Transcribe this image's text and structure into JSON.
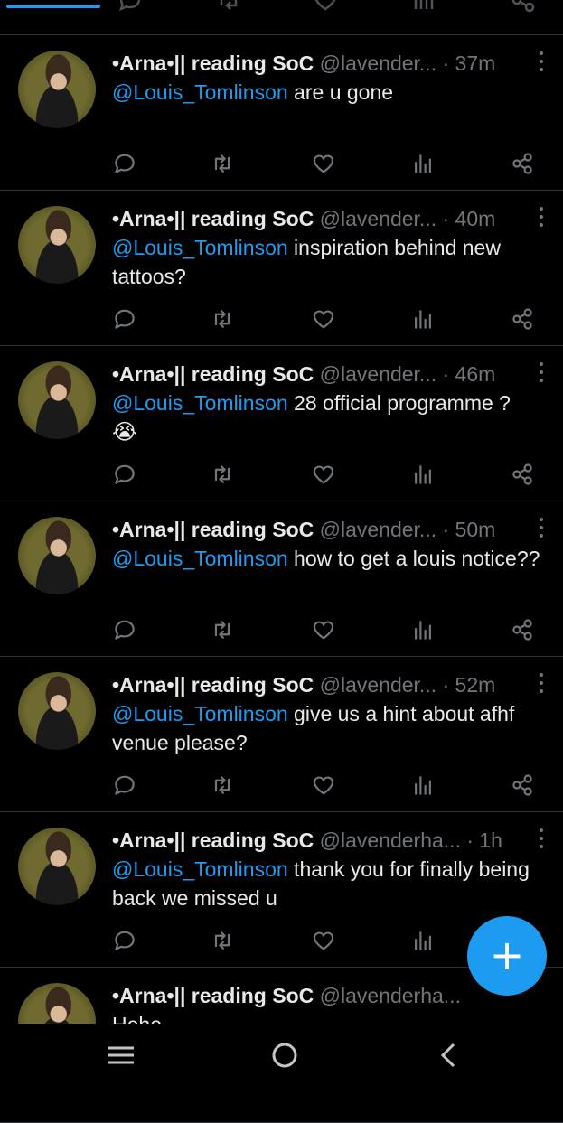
{
  "colors": {
    "background": "#000000",
    "accent": "#1d9bf0",
    "text": "#e7e9ea",
    "muted": "#71767b",
    "divider": "#2f3336"
  },
  "action_icons": [
    "reply-icon",
    "retweet-icon",
    "like-icon",
    "views-icon",
    "share-icon"
  ],
  "tweets": [
    {
      "name": "•Arna•|| reading SoC",
      "handle": "@lavender...",
      "time": "· 37m",
      "mention": "@Louis_Tomlinson",
      "text": " are u gone"
    },
    {
      "name": "•Arna•|| reading SoC",
      "handle": "@lavender...",
      "time": "· 40m",
      "mention": "@Louis_Tomlinson",
      "text": " inspiration behind new tattoos?"
    },
    {
      "name": "•Arna•|| reading SoC",
      "handle": "@lavender...",
      "time": "· 46m",
      "mention": "@Louis_Tomlinson",
      "text": " 28 official programme ?",
      "emoji": "😭"
    },
    {
      "name": "•Arna•|| reading SoC",
      "handle": "@lavender...",
      "time": "· 50m",
      "mention": "@Louis_Tomlinson",
      "text": " how to get a louis notice??"
    },
    {
      "name": "•Arna•|| reading SoC",
      "handle": "@lavender...",
      "time": "· 52m",
      "mention": "@Louis_Tomlinson",
      "text": " give us a hint about afhf venue please?"
    },
    {
      "name": "•Arna•|| reading SoC",
      "handle": "@lavenderha...",
      "time": "· 1h",
      "mention": "@Louis_Tomlinson",
      "text": " thank you for finally being back we missed u"
    },
    {
      "name": "•Arna•|| reading SoC",
      "handle": "@lavenderha...",
      "time": "",
      "mention": "",
      "text": "Hehe"
    }
  ],
  "fab": {
    "label": "+",
    "icon": "compose-plus-icon"
  },
  "system_nav": [
    "recent-apps-icon",
    "home-circle-icon",
    "back-chevron-icon"
  ]
}
